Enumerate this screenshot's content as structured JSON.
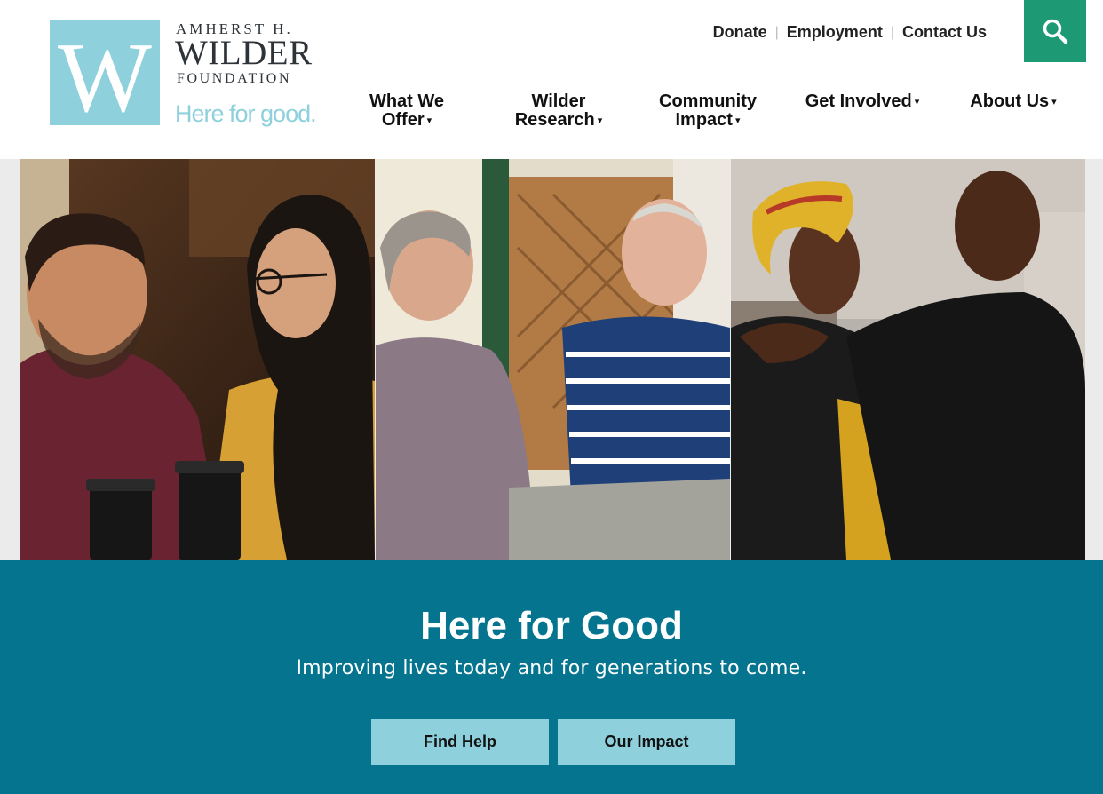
{
  "brand": {
    "line1": "AMHERST H.",
    "line2": "WILDER",
    "line3": "FOUNDATION",
    "tagline": "Here for good.",
    "mark_letter": "W",
    "accent_color": "#8ed1dc",
    "text_color": "#2d3338"
  },
  "utility_nav": {
    "items": [
      "Donate",
      "Employment",
      "Contact Us"
    ],
    "separator": "|"
  },
  "search": {
    "icon": "search-icon",
    "color": "#1d9a73"
  },
  "main_nav": {
    "items": [
      {
        "line1": "What We",
        "line2": "Offer",
        "dropdown": true
      },
      {
        "line1": "Wilder",
        "line2": "Research",
        "dropdown": true
      },
      {
        "line1": "Community",
        "line2": "Impact",
        "dropdown": true
      },
      {
        "line1": "Get Involved",
        "line2": "",
        "dropdown": true
      },
      {
        "line1": "About Us",
        "line2": "",
        "dropdown": true
      }
    ],
    "caret": "▾"
  },
  "hero": {
    "photos": [
      "photo-friends-cafe",
      "photo-elderly-couple",
      "photo-couple-embrace"
    ]
  },
  "banner": {
    "title": "Here for Good",
    "subtitle": "Improving lives today and for generations to come.",
    "buttons": [
      "Find Help",
      "Our Impact"
    ],
    "background": "#04748f",
    "button_color": "#8ed1dc"
  }
}
